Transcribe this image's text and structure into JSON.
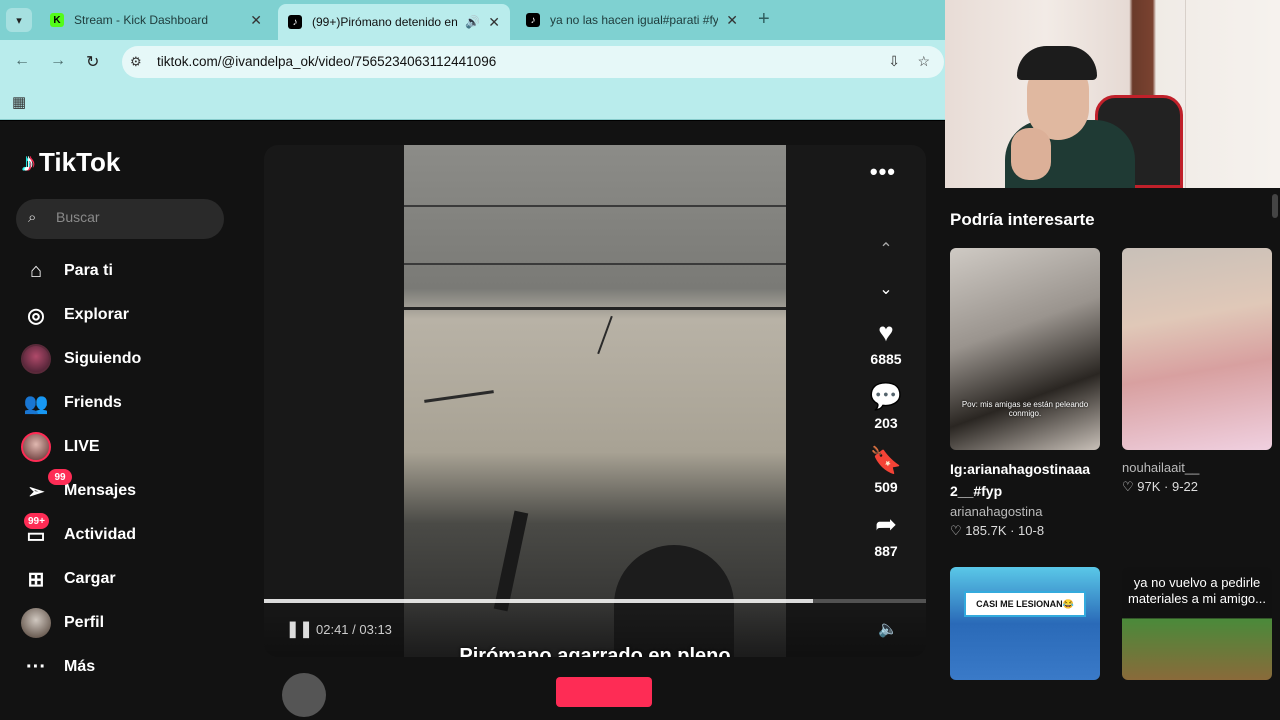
{
  "browser": {
    "tabs": [
      {
        "title": "Stream - Kick Dashboard",
        "favicon": "kick-icon",
        "active": false
      },
      {
        "title": "(99+)Pirómano detenido en",
        "favicon": "tiktok-icon",
        "active": true,
        "audio": true
      },
      {
        "title": "ya no las hacen igual#parati #fy",
        "favicon": "tiktok-icon",
        "active": false
      }
    ],
    "url": "tiktok.com/@ivandelpa_ok/video/7565234063112441096"
  },
  "tiktok": {
    "brand": "TikTok",
    "search_placeholder": "Buscar",
    "nav": [
      {
        "label": "Para ti",
        "icon": "home-icon"
      },
      {
        "label": "Explorar",
        "icon": "compass-icon"
      },
      {
        "label": "Siguiendo",
        "icon": "following-avatar"
      },
      {
        "label": "Friends",
        "icon": "friends-icon"
      },
      {
        "label": "LIVE",
        "icon": "live-avatar"
      },
      {
        "label": "Mensajes",
        "icon": "messages-icon",
        "badge": "99"
      },
      {
        "label": "Actividad",
        "icon": "activity-icon",
        "badge": "99+"
      },
      {
        "label": "Cargar",
        "icon": "upload-icon"
      },
      {
        "label": "Perfil",
        "icon": "profile-avatar"
      },
      {
        "label": "Más",
        "icon": "more-icon"
      }
    ],
    "video": {
      "time": "02:41 / 03:13",
      "progress": 0.83,
      "caption": "Pirómano agarrado en pleno",
      "likes": "6885",
      "comments": "203",
      "saves": "509",
      "shares": "887"
    }
  },
  "sidebar": {
    "title": "Podría interesarte",
    "cards": [
      {
        "title": "Ig:arianahagostinaaa2__#fyp",
        "title_l1": "Ig:arianahagostinaaa",
        "title_l2": "2__#fyp",
        "user": "arianahagostina",
        "likes": "185.7K",
        "date": "10-8",
        "thumb_sub": "Pov: mis amigas se están peleando conmigo."
      },
      {
        "title": "",
        "user": "nouhailaait__",
        "likes": "97K",
        "date": "9-22"
      },
      {
        "thumb_label": "CASI ME LESIONAN😂"
      },
      {
        "thumb_text": "ya no vuelvo a pedirle materiales a mi amigo..."
      }
    ]
  },
  "colors": {
    "accent": "#fe2c55",
    "tab_bar": "#7fd1d1",
    "toolbar": "#b9ecec",
    "page_bg": "#121212"
  }
}
